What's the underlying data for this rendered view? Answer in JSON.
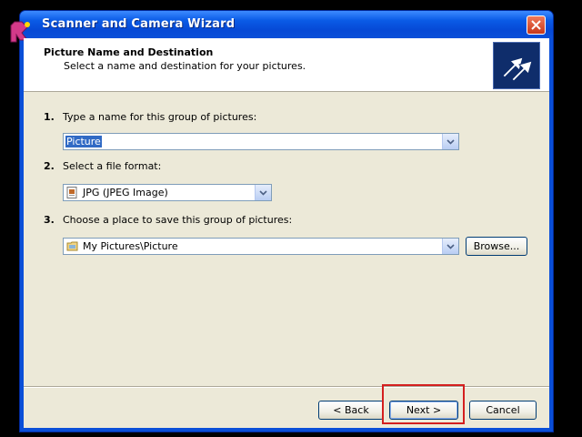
{
  "window": {
    "title": "Scanner and Camera Wizard"
  },
  "header": {
    "title": "Picture Name and Destination",
    "subtitle": "Select a name and destination for your pictures."
  },
  "steps": [
    {
      "number": "1.",
      "label": "Type a name for this group of pictures:",
      "value": "Picture"
    },
    {
      "number": "2.",
      "label": "Select a file format:",
      "value": "JPG (JPEG Image)"
    },
    {
      "number": "3.",
      "label": "Choose a place to save this group of pictures:",
      "value": "My Pictures\\Picture"
    }
  ],
  "buttons": {
    "browse": "Browse...",
    "back": "< Back",
    "next": "Next >",
    "cancel": "Cancel"
  },
  "colors": {
    "titlebar": "#0a4fd8",
    "highlight": "#d41f1f",
    "selection": "#316ac5"
  }
}
